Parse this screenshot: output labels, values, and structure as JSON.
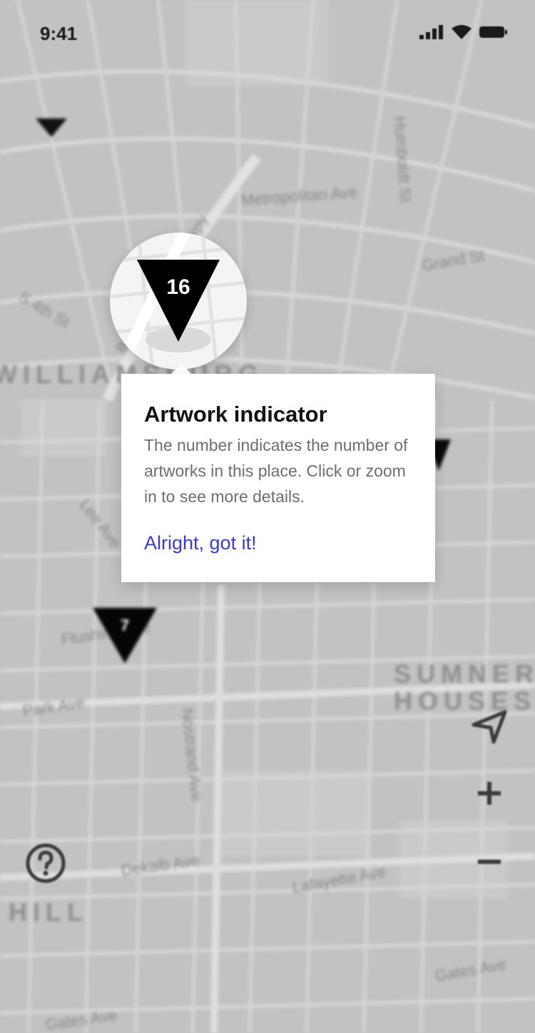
{
  "status_bar": {
    "time": "9:41"
  },
  "map": {
    "street_labels": [
      "Metropolitan Ave",
      "Grand St",
      "Humboldt St",
      "S 4th St",
      "Lee Ave",
      "Flushing Ave",
      "Park Ave",
      "Nostrand Ave",
      "Dekalb Ave",
      "Lafayette Ave",
      "Gates Ave",
      "Gates Ave",
      "Brooklyn Queens Expy"
    ],
    "area_labels": [
      "WILLIAMSBURG",
      "SUMNER\nHOUSES",
      "HILL"
    ],
    "pins": [
      {
        "count": "7"
      }
    ],
    "colors": {
      "background": "#c2c2c2",
      "streets": "#d6d6d6",
      "pin": "#050505"
    }
  },
  "magnifier": {
    "count": "16"
  },
  "tooltip": {
    "title": "Artwork indicator",
    "body": "The number indicates the number of artworks in this place. Click or zoom in to see more details.",
    "action_label": "Alright, got it!",
    "action_color": "#3b3bd1"
  },
  "controls": {
    "icons": [
      "help-icon",
      "locate-icon",
      "zoom-in-icon",
      "zoom-out-icon"
    ]
  }
}
